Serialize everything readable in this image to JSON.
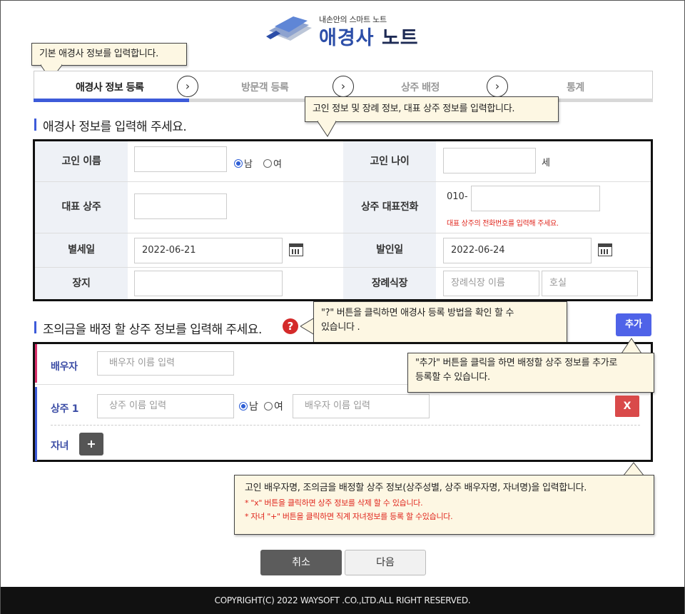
{
  "logo": {
    "tagline": "내손안의 스마트 노트",
    "title_blue": "애경사",
    "title_dark": "노트"
  },
  "bubbles": {
    "basic_info": "기본 애경사 정보를 입력합니다.",
    "deceased_info": "고인 정보 및 장례 정보, 대표 상주 정보를 입력합니다.",
    "help_line1": "\"?\" 버튼을 클릭하면  애경사 등록 방법을 확인 할 수",
    "help_line2": "있습니다 .",
    "add_line1": "\"추가\" 버튼을 클릭을 하면 배정할 상주 정보를 추가로",
    "add_line2": "등록할 수 있습니다.",
    "bottom_line1": "고인 배우자명, 조의금을 배정할 상주 정보(상주성별, 상주 배우자명, 자녀명)을 입력합니다.",
    "bottom_line2": "* \"x\" 버튼을 클릭하면 상주 정보를 삭제 할 수 있습니다.",
    "bottom_line3": "* 자녀 \"+\" 버튼을 클릭하면 직계 자녀정보를 등록 할 수있습니다."
  },
  "steps": [
    {
      "label": "애경사 정보 등록"
    },
    {
      "label": "방문객 등록"
    },
    {
      "label": "상주 배정"
    },
    {
      "label": "통계"
    }
  ],
  "step_arrow": "›",
  "section1": {
    "title": "애경사 정보를 입력해 주세요."
  },
  "form": {
    "deceased_name_label": "고인 이름",
    "deceased_name_value": "",
    "gender_male": "남",
    "gender_female": "여",
    "deceased_age_label": "고인 나이",
    "deceased_age_value": "",
    "age_unit": "세",
    "chief_mourner_label": "대표 상주",
    "chief_mourner_value": "",
    "mourner_phone_label": "상주 대표전화",
    "phone_prefix": "010-",
    "phone_value": "",
    "phone_note": "대표 상주의 전화번호를 입력해 주세요.",
    "death_date_label": "별세일",
    "death_date_value": "2022-06-21",
    "funeral_date_label": "발인일",
    "funeral_date_value": "2022-06-24",
    "burial_label": "장지",
    "burial_value": "",
    "funeral_hall_label": "장례식장",
    "funeral_hall_placeholder": "장례식장 이름",
    "room_placeholder": "호실"
  },
  "section2": {
    "title": "조의금을 배정 할 상주 정보를 입력해 주세요.",
    "help": "?"
  },
  "add_button": "추가",
  "sangju": {
    "spouse_label": "배우자",
    "spouse_placeholder": "배우자 이름 입력",
    "mourner1_label": "상주 1",
    "mourner1_placeholder": "상주 이름 입력",
    "gender_male": "남",
    "gender_female": "여",
    "mourner1_spouse_placeholder": "배우자 이름 입력",
    "delete_button": "X",
    "children_label": "자녀",
    "add_child_button": "+"
  },
  "buttons": {
    "cancel": "취소",
    "next": "다음"
  },
  "footer": "COPYRIGHT(C) 2022 WAYSOFT .CO.,LTD.ALL RIGHT RESERVED.",
  "colors": {
    "accent": "#3d5bd9",
    "add_button": "#4f63e8",
    "delete_button": "#d94a4a",
    "bubble_bg": "#fdf7e3",
    "footer_bg": "#111111"
  }
}
